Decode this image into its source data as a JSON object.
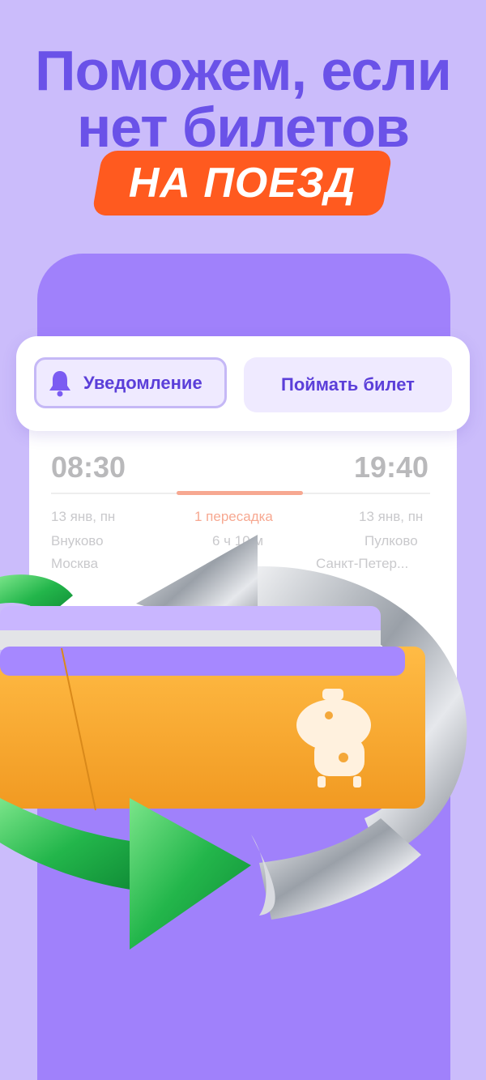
{
  "headline": {
    "line1": "Поможем, если",
    "line2": "нет билетов",
    "badge": "НА ПОЕЗД"
  },
  "actions": {
    "notify_label": "Уведомление",
    "catch_label": "Поймать билет"
  },
  "ticket": {
    "departure_time": "08:30",
    "arrival_time": "19:40",
    "departure_date": "13 янв, пн",
    "arrival_date": "13 янв, пн",
    "transfers": "1 пересадка",
    "duration": "6 ч 10 м",
    "departure_station": "Внуково",
    "departure_city": "Москва",
    "arrival_station": "Пулково",
    "arrival_city": "Санкт-Петер..."
  },
  "colors": {
    "background": "#cbbcfb",
    "headline": "#6a52e8",
    "badge": "#ff5a1f",
    "phone": "#a081fb",
    "button_text": "#5b3fd9",
    "route_highlight": "#f7a891",
    "ticket_orange": "#f7ab33",
    "arrow_green": "#2fc456",
    "arrow_silver": "#b8bcc2"
  },
  "icons": {
    "notify": "bell-icon",
    "mascot": "robot-mascot-icon",
    "arrow_left": "green-arrow-icon",
    "arrow_right": "silver-arrow-icon"
  }
}
